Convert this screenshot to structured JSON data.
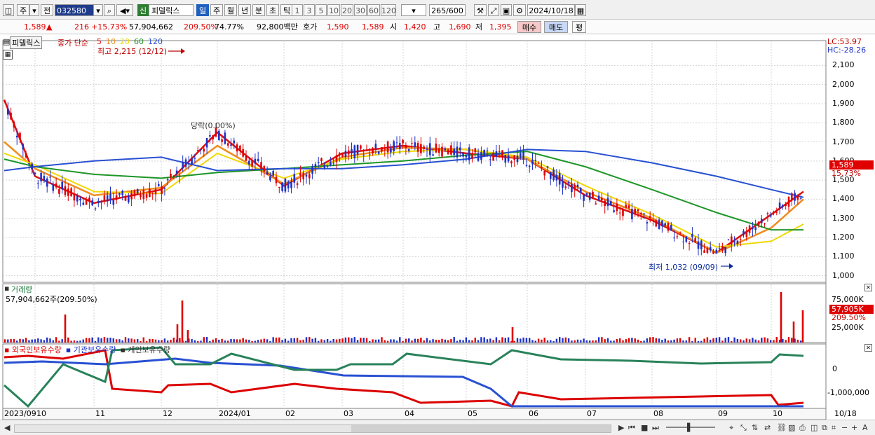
{
  "toolbar": {
    "market": "주",
    "market_alt": "전",
    "stock_code": "032580",
    "stock_name_tag": "신",
    "stock_name": "피델릭스",
    "periods": [
      "일",
      "주",
      "월",
      "년",
      "분",
      "초",
      "틱"
    ],
    "active_period": "일",
    "counts": [
      "1",
      "3",
      "5",
      "10",
      "20",
      "30",
      "60",
      "120"
    ],
    "range_value": "265",
    "range_total": "/600",
    "date": "2024/10/18"
  },
  "quote": {
    "price": "1,589",
    "change_arrow": "▲",
    "change": "216",
    "change_pct": "+15.73%",
    "volume": "57,904,662",
    "volume_ratio": "209.50%",
    "turnover": "74.77%",
    "amount": "92,800백만",
    "bid_label": "호가",
    "ask": "1,590",
    "bid": "1,589",
    "open_label": "시",
    "open": "1,420",
    "high_label": "고",
    "high": "1,690",
    "low_label": "저",
    "low": "1,395",
    "buy_button": "매수",
    "sell_button": "매도",
    "avg_button": "평"
  },
  "price_panel": {
    "name": "피델릭스",
    "ma_label": "종가 단순",
    "ma_periods": [
      "5",
      "10",
      "20",
      "60",
      "120"
    ],
    "ma_colors": [
      "#e01010",
      "#f08c1e",
      "#f0d800",
      "#1e9628",
      "#2850d2"
    ],
    "max_label": "최고 2,215 (12/12)",
    "min_label": "최저 1,032 (09/09)",
    "annotation": "당락(0.00%)",
    "lc": "LC:53.97",
    "hc": "HC:-28.26",
    "y_ticks": [
      "2,100",
      "2,000",
      "1,900",
      "1,800",
      "1,700",
      "1,600",
      "1,500",
      "1,400",
      "1,300",
      "1,200",
      "1,100",
      "1,000"
    ],
    "price_badge": "1,589",
    "pct_badge": "15.73%"
  },
  "volume_panel": {
    "title": "거래량",
    "value": "57,904,662주(209.50%)",
    "y_ticks": [
      "75,000K",
      "50,000K",
      "25,000K"
    ],
    "badge": "57,905K",
    "badge_pct": "209.50%"
  },
  "holder_panel": {
    "series_names": [
      "외국인보유수량",
      "기관보유수량",
      "개인보유수량"
    ],
    "series_colors": [
      "#dc0000",
      "#2850d2",
      "#28825a"
    ],
    "y_ticks": [
      "0",
      "-1,000,000"
    ]
  },
  "x_axis": {
    "labels": [
      "2023/09",
      "10",
      "11",
      "12",
      "2024/01",
      "02",
      "03",
      "04",
      "05",
      "06",
      "07",
      "08",
      "09",
      "10"
    ],
    "right_label": "10/18"
  },
  "colors": {
    "up": "#e00000",
    "down": "#1e32c8",
    "grid": "#d4d4d4"
  },
  "chart_data": {
    "type": "line",
    "title": "피델릭스",
    "xlabel": "",
    "ylabel": "",
    "ylim": [
      980,
      2215
    ],
    "x": [
      "2023/09",
      "2023/10",
      "2023/11",
      "2023/12",
      "2024/01",
      "2024/02",
      "2024/03",
      "2024/04",
      "2024/05",
      "2024/06",
      "2024/07",
      "2024/08",
      "2024/09",
      "2024/10",
      "2024/10/18"
    ],
    "series": [
      {
        "name": "5",
        "values": [
          1920,
          1520,
          1380,
          1450,
          1750,
          1470,
          1640,
          1680,
          1640,
          1610,
          1420,
          1290,
          1120,
          1320,
          1440
        ]
      },
      {
        "name": "10",
        "values": [
          1700,
          1560,
          1420,
          1460,
          1680,
          1480,
          1620,
          1670,
          1660,
          1610,
          1440,
          1300,
          1120,
          1250,
          1400
        ]
      },
      {
        "name": "20",
        "values": [
          1640,
          1580,
          1440,
          1430,
          1640,
          1510,
          1610,
          1650,
          1660,
          1620,
          1470,
          1320,
          1150,
          1180,
          1270
        ]
      },
      {
        "name": "60",
        "values": [
          1610,
          1570,
          1530,
          1510,
          1540,
          1560,
          1580,
          1600,
          1630,
          1650,
          1570,
          1450,
          1330,
          1240,
          1240
        ]
      },
      {
        "name": "120",
        "values": [
          1550,
          1570,
          1600,
          1620,
          1550,
          1560,
          1560,
          1580,
          1610,
          1660,
          1650,
          1590,
          1520,
          1450,
          1410
        ]
      }
    ]
  }
}
